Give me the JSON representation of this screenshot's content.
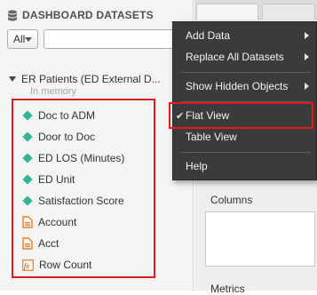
{
  "left_panel": {
    "title": "DASHBOARD DATASETS",
    "filter": {
      "selected": "All",
      "placeholder": ""
    },
    "dataset": {
      "name": "ER Patients (ED External D...",
      "status": "In memory"
    },
    "fields": [
      {
        "label": "Doc to ADM",
        "icon": "metric-diamond-icon"
      },
      {
        "label": "Door to Doc",
        "icon": "metric-diamond-icon"
      },
      {
        "label": "ED LOS (Minutes)",
        "icon": "metric-diamond-icon"
      },
      {
        "label": "ED Unit",
        "icon": "metric-diamond-icon"
      },
      {
        "label": "Satisfaction Score",
        "icon": "metric-diamond-icon"
      },
      {
        "label": "Account",
        "icon": "attribute-icon"
      },
      {
        "label": "Acct",
        "icon": "attribute-icon"
      },
      {
        "label": "Row Count",
        "icon": "fx-icon"
      }
    ]
  },
  "right_panel": {
    "columns_label": "Columns",
    "metrics_label": "Metrics"
  },
  "menu": {
    "items": [
      {
        "label": "Add Data",
        "submenu": true
      },
      {
        "label": "Replace All Datasets",
        "submenu": true
      },
      {
        "label": "Show Hidden Objects",
        "submenu": true
      },
      {
        "label": "Flat View",
        "checked": true
      },
      {
        "label": "Table View"
      },
      {
        "label": "Help"
      }
    ]
  },
  "colors": {
    "highlight": "#e01b1b",
    "metric": "#2fb39a",
    "attribute": "#e8822a",
    "menu_bg": "#3b3b3b"
  }
}
